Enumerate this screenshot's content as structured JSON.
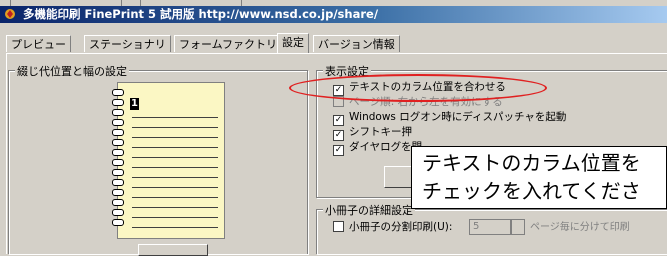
{
  "window": {
    "title": "多機能印刷 FinePrint 5 試用版  http://www.nsd.co.jp/share/"
  },
  "tabs": [
    {
      "label": "プレビュー"
    },
    {
      "label": "ステーショナリ"
    },
    {
      "label": "フォームファクトリ"
    },
    {
      "label": "設定"
    },
    {
      "label": "バージョン情報"
    }
  ],
  "binding_group": {
    "legend": "綴じ代位置と幅の設定",
    "preview_page_number": "1"
  },
  "display_group": {
    "legend": "表示設定",
    "options": [
      {
        "label": "テキストのカラム位置を合わせる",
        "checked": true,
        "enabled": true
      },
      {
        "label": "ページ順: 右から左を有効にする",
        "checked": false,
        "enabled": false
      },
      {
        "label": "Windows ログオン時にディスパッチャを起動",
        "checked": true,
        "enabled": true
      },
      {
        "label": "シフトキー押",
        "checked": true,
        "enabled": true
      },
      {
        "label": "ダイヤログを閉",
        "checked": true,
        "enabled": true
      }
    ]
  },
  "booklet_group": {
    "legend": "小冊子の詳細設定",
    "split_print_label": "小冊子の分割印刷(U):",
    "split_print_checked": false,
    "split_value": "5",
    "pages_suffix": "ページ毎に分けて印刷"
  },
  "callout": {
    "line1": "テキストのカラム位置を",
    "line2": "チェックを入れてくださ"
  },
  "colors": {
    "highlight_ellipse": "#e02020",
    "titlebar_start": "#0a246a",
    "titlebar_end": "#a6caf0"
  }
}
